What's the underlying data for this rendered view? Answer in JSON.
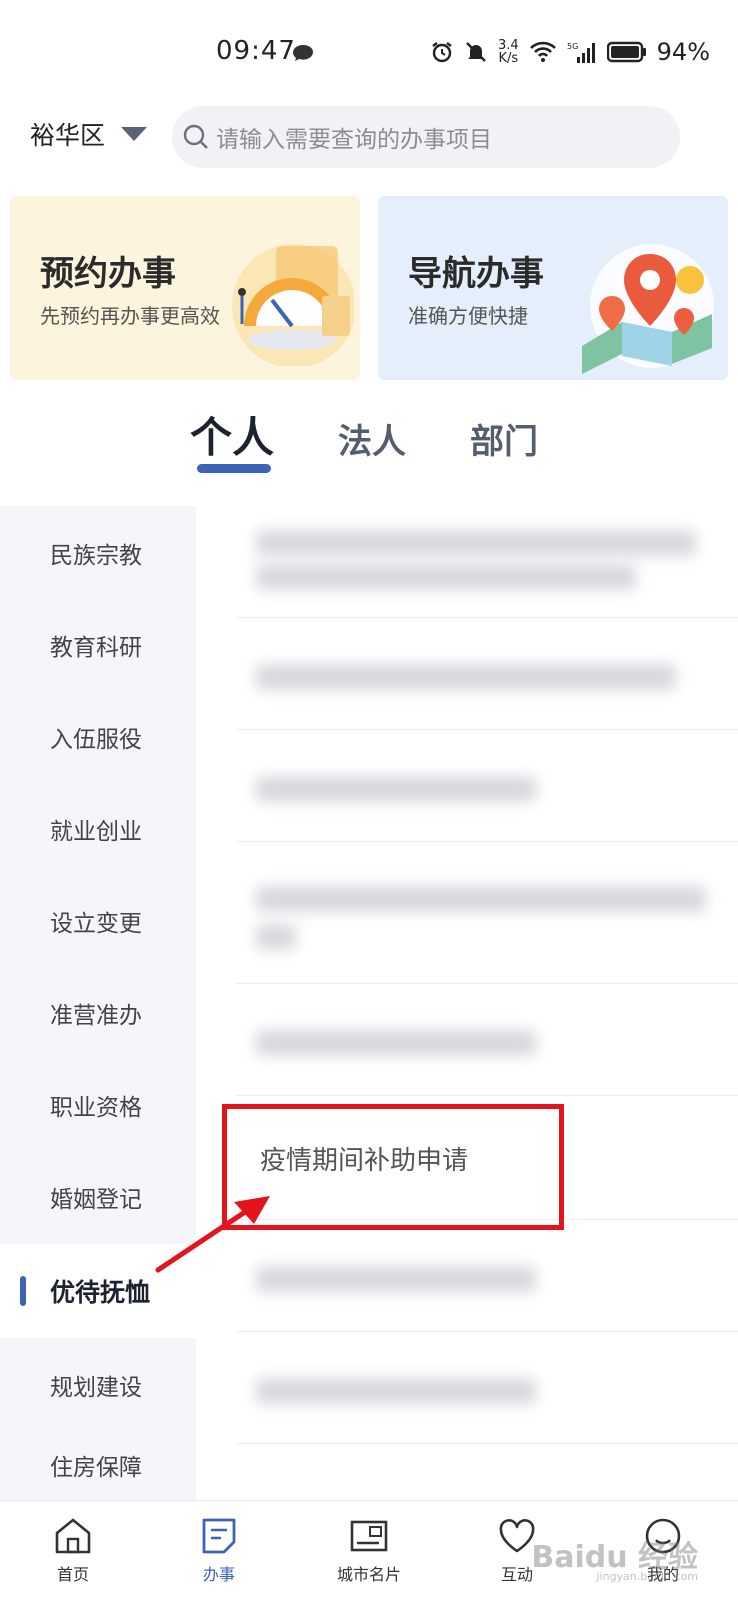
{
  "status_bar": {
    "time": "09:47",
    "net_speed_top": "3.4",
    "net_speed_bottom": "K/s",
    "network": "5G",
    "battery": "94%"
  },
  "header": {
    "region": "裕华区",
    "search_placeholder": "请输入需要查询的办事项目"
  },
  "banners": [
    {
      "title": "预约办事",
      "subtitle": "先预约再办事更高效"
    },
    {
      "title": "导航办事",
      "subtitle": "准确方便快捷"
    }
  ],
  "tabs": [
    {
      "label": "个人",
      "active": true
    },
    {
      "label": "法人",
      "active": false
    },
    {
      "label": "部门",
      "active": false
    }
  ],
  "sidebar": {
    "items": [
      {
        "label": "民族宗教"
      },
      {
        "label": "教育科研"
      },
      {
        "label": "入伍服役"
      },
      {
        "label": "就业创业"
      },
      {
        "label": "设立变更"
      },
      {
        "label": "准营准办"
      },
      {
        "label": "职业资格"
      },
      {
        "label": "婚姻登记"
      },
      {
        "label": "优待抚恤",
        "active": true
      },
      {
        "label": "规划建设"
      },
      {
        "label": "住房保障"
      }
    ]
  },
  "content": {
    "highlighted_item": "疫情期间补助申请"
  },
  "bottom_nav": {
    "items": [
      {
        "label": "首页"
      },
      {
        "label": "办事",
        "active": true
      },
      {
        "label": "城市名片"
      },
      {
        "label": "互动"
      },
      {
        "label": "我的"
      }
    ]
  },
  "watermark": {
    "brand": "Baidu 经验",
    "url": "jingyan.baidu.com"
  },
  "colors": {
    "accent": "#3d63b6",
    "annotation": "#e3141b",
    "sidebar_bg": "#f4f6f9"
  }
}
